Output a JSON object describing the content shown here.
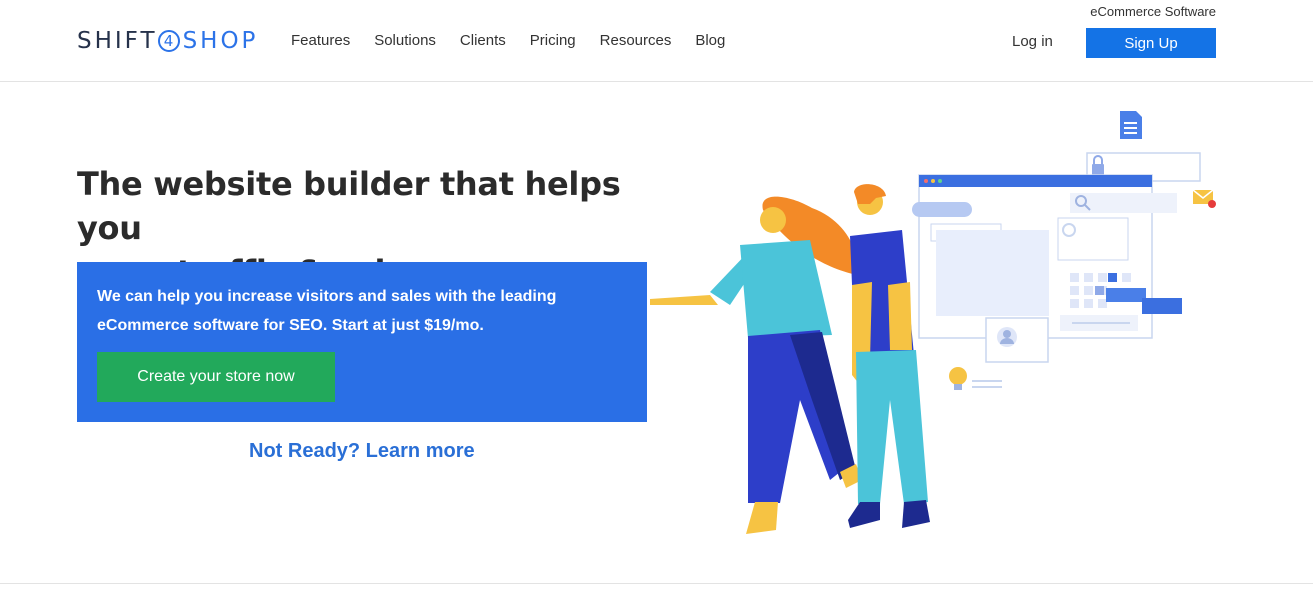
{
  "header": {
    "logo": {
      "part1": "SHIFT",
      "four": "4",
      "part2": "SHOP"
    },
    "nav": [
      "Features",
      "Solutions",
      "Clients",
      "Pricing",
      "Resources",
      "Blog"
    ],
    "tagline": "eCommerce Software",
    "login_label": "Log in",
    "signup_label": "Sign Up"
  },
  "hero": {
    "title_line1": "The website builder that helps you",
    "title_line2": "grow traffic & sales",
    "description": "We can help you increase visitors and sales with the leading eCommerce software for SEO. Start at just $19/mo.",
    "cta_label": "Create your store now",
    "secondary_link": "Not Ready? Learn more"
  },
  "colors": {
    "brand_blue": "#2a6fe6",
    "signup_blue": "#1473e6",
    "cta_green": "#22a95b",
    "link_blue": "#2a6fd6"
  },
  "illustration": {
    "icons": [
      "document-icon",
      "lock-icon",
      "search-icon",
      "envelope-icon",
      "user-icon",
      "lightbulb-icon",
      "chat-bubble-icon"
    ]
  }
}
